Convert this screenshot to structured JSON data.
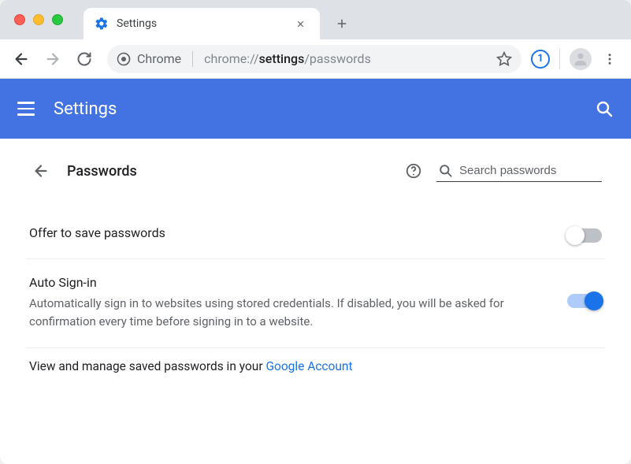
{
  "browser": {
    "tab": {
      "title": "Settings"
    },
    "omnibox": {
      "scheme_label": "Chrome",
      "url_prefix": "chrome://",
      "url_bold": "settings",
      "url_suffix": "/passwords"
    },
    "extension_badge": "1"
  },
  "appbar": {
    "title": "Settings"
  },
  "page": {
    "title": "Passwords",
    "search_placeholder": "Search passwords",
    "rows": {
      "offer_save": {
        "label": "Offer to save passwords",
        "enabled": false
      },
      "auto_signin": {
        "label": "Auto Sign-in",
        "desc": "Automatically sign in to websites using stored credentials. If disabled, you will be asked for confirmation every time before signing in to a website.",
        "enabled": true
      }
    },
    "footer_prefix": "View and manage saved passwords in your ",
    "footer_link": "Google Account"
  }
}
